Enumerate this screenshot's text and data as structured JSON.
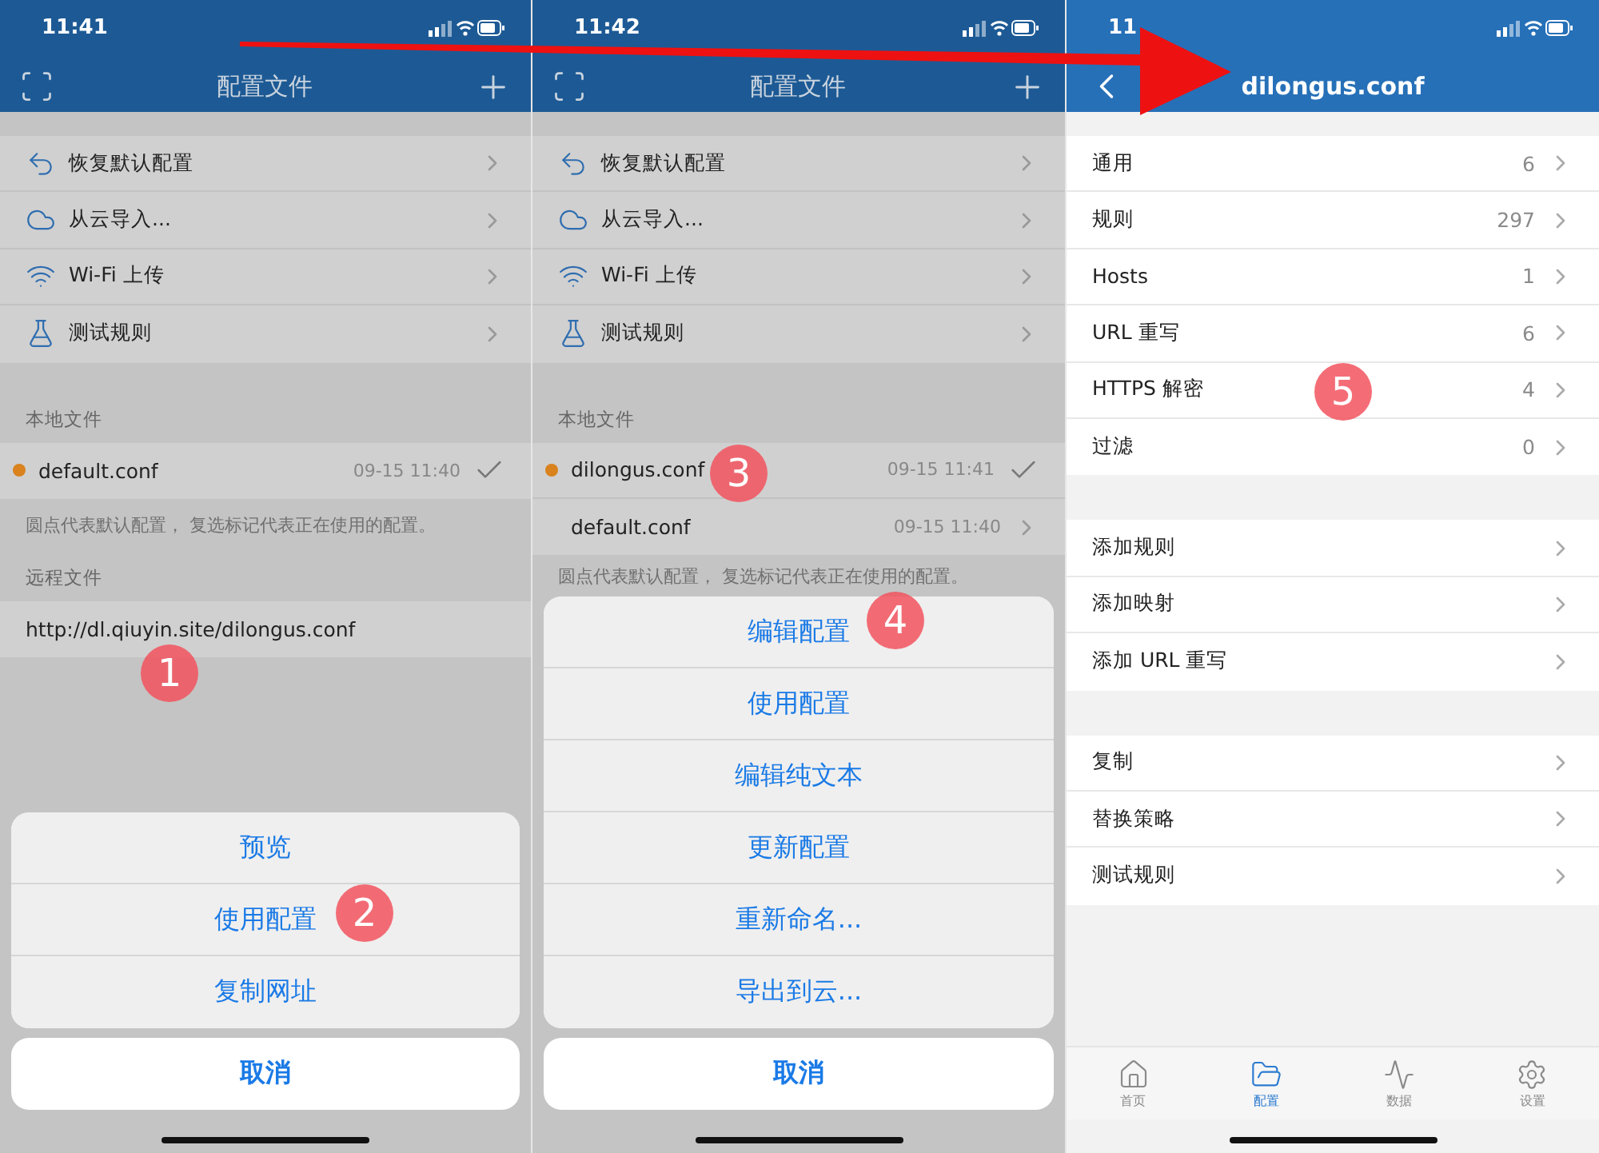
{
  "panels": [
    {
      "kind": "config_list",
      "status_time": "11:41",
      "nav_title": "配置文件",
      "menu": [
        {
          "label": "恢复默认配置"
        },
        {
          "label": "从云导入..."
        },
        {
          "label": "Wi-Fi 上传"
        },
        {
          "label": "测试规则"
        }
      ],
      "local_heading": "本地文件",
      "local_files": [
        {
          "name": "default.conf",
          "default": true,
          "in_use": true,
          "time": "09-15 11:40"
        }
      ],
      "note": "圆点代表默认配置， 复选标记代表正在使用的配置。",
      "remote_heading": "远程文件",
      "remote_files": [
        {
          "url": "http://dl.qiuyin.site/dilongus.conf"
        }
      ],
      "action_sheet": {
        "actions": [
          "预览",
          "使用配置",
          "复制网址"
        ],
        "cancel": "取消"
      }
    },
    {
      "kind": "config_list",
      "status_time": "11:42",
      "nav_title": "配置文件",
      "menu": [
        {
          "label": "恢复默认配置"
        },
        {
          "label": "从云导入..."
        },
        {
          "label": "Wi-Fi 上传"
        },
        {
          "label": "测试规则"
        }
      ],
      "local_heading": "本地文件",
      "local_files": [
        {
          "name": "dilongus.conf",
          "default": true,
          "in_use": true,
          "time": "09-15 11:41"
        },
        {
          "name": "default.conf",
          "default": false,
          "in_use": false,
          "time": "09-15 11:40"
        }
      ],
      "note": "圆点代表默认配置， 复选标记代表正在使用的配置。",
      "action_sheet": {
        "actions": [
          "编辑配置",
          "使用配置",
          "编辑纯文本",
          "更新配置",
          "重新命名...",
          "导出到云..."
        ],
        "cancel": "取消"
      }
    },
    {
      "kind": "config_detail",
      "status_time": "11",
      "nav_title": "dilongus.conf",
      "groups": [
        [
          {
            "label": "通用",
            "count": "6"
          },
          {
            "label": "规则",
            "count": "297"
          },
          {
            "label": "Hosts",
            "count": "1"
          },
          {
            "label": "URL 重写",
            "count": "6"
          },
          {
            "label": "HTTPS 解密",
            "count": "4"
          },
          {
            "label": "过滤",
            "count": "0"
          }
        ],
        [
          {
            "label": "添加规则"
          },
          {
            "label": "添加映射"
          },
          {
            "label": "添加 URL 重写"
          }
        ],
        [
          {
            "label": "复制"
          },
          {
            "label": "替换策略"
          },
          {
            "label": "测试规则"
          }
        ]
      ],
      "tabs": [
        {
          "label": "首页",
          "selected": false
        },
        {
          "label": "配置",
          "selected": true
        },
        {
          "label": "数据",
          "selected": false
        },
        {
          "label": "设置",
          "selected": false
        }
      ]
    }
  ],
  "markers": [
    "1",
    "2",
    "3",
    "4",
    "5"
  ]
}
